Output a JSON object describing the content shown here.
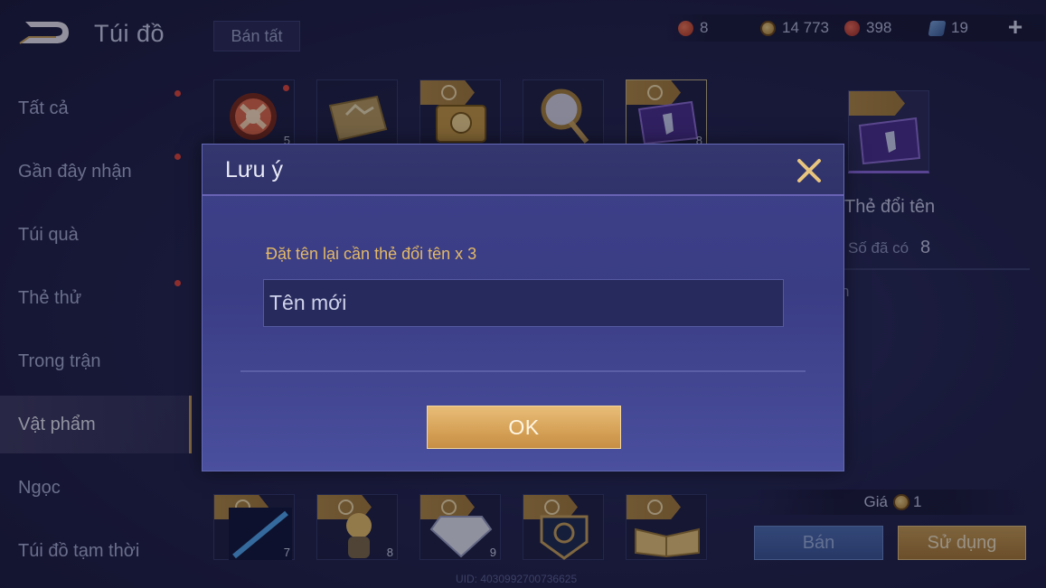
{
  "header": {
    "title": "Túi đồ",
    "sell_all": "Bán tất",
    "currencies": [
      {
        "icon": "red-gem-icon",
        "value": "8"
      },
      {
        "icon": "gold-coin-icon",
        "value": "14 773"
      },
      {
        "icon": "voucher-icon",
        "value": "398"
      },
      {
        "icon": "rename-card-icon",
        "value": "19"
      }
    ],
    "add_label": "+"
  },
  "sidebar": {
    "items": [
      {
        "label": "Tất cả",
        "badge": true
      },
      {
        "label": "Gần đây nhận",
        "badge": true
      },
      {
        "label": "Túi quà",
        "badge": false
      },
      {
        "label": "Thẻ thử",
        "badge": true
      },
      {
        "label": "Trong trận",
        "badge": false
      },
      {
        "label": "Vật phẩm",
        "badge": false,
        "active": true
      },
      {
        "label": "Ngọc",
        "badge": false
      },
      {
        "label": "Túi đồ tạm thời",
        "badge": false
      }
    ]
  },
  "grid": {
    "top_row": [
      {
        "icon": "emblem-orb-icon",
        "count": "5",
        "badge": true
      },
      {
        "icon": "gold-ticket-icon",
        "count": ""
      },
      {
        "icon": "gold-chest-icon",
        "count": ""
      },
      {
        "icon": "orb-staff-icon",
        "count": ""
      },
      {
        "icon": "rename-card-icon",
        "count": "8"
      }
    ],
    "bottom_row": [
      {
        "icon": "blue-spear-icon",
        "count": "7"
      },
      {
        "icon": "hero-figure-icon",
        "count": "8"
      },
      {
        "icon": "diamond-icon",
        "count": "9"
      },
      {
        "icon": "lion-crest-icon",
        "count": ""
      },
      {
        "icon": "open-book-icon",
        "count": ""
      }
    ]
  },
  "uid": "UID: 4030992700736625",
  "detail": {
    "name": "Thẻ đổi tên",
    "owned_label": "Số đã có",
    "owned_value": "8",
    "partial_text": "n",
    "price_label": "Giá",
    "price_value": "1",
    "sell_label": "Bán",
    "use_label": "Sử dụng"
  },
  "dialog": {
    "title": "Lưu ý",
    "message": "Đặt tên lại cần thẻ đổi tên x 3",
    "input_value": "Tên mới",
    "ok_label": "OK"
  },
  "colors": {
    "accent_gold": "#c9a25b",
    "dialog_bg": "#3e4189",
    "message": "#e3b867",
    "badge_red": "#e0473a"
  }
}
